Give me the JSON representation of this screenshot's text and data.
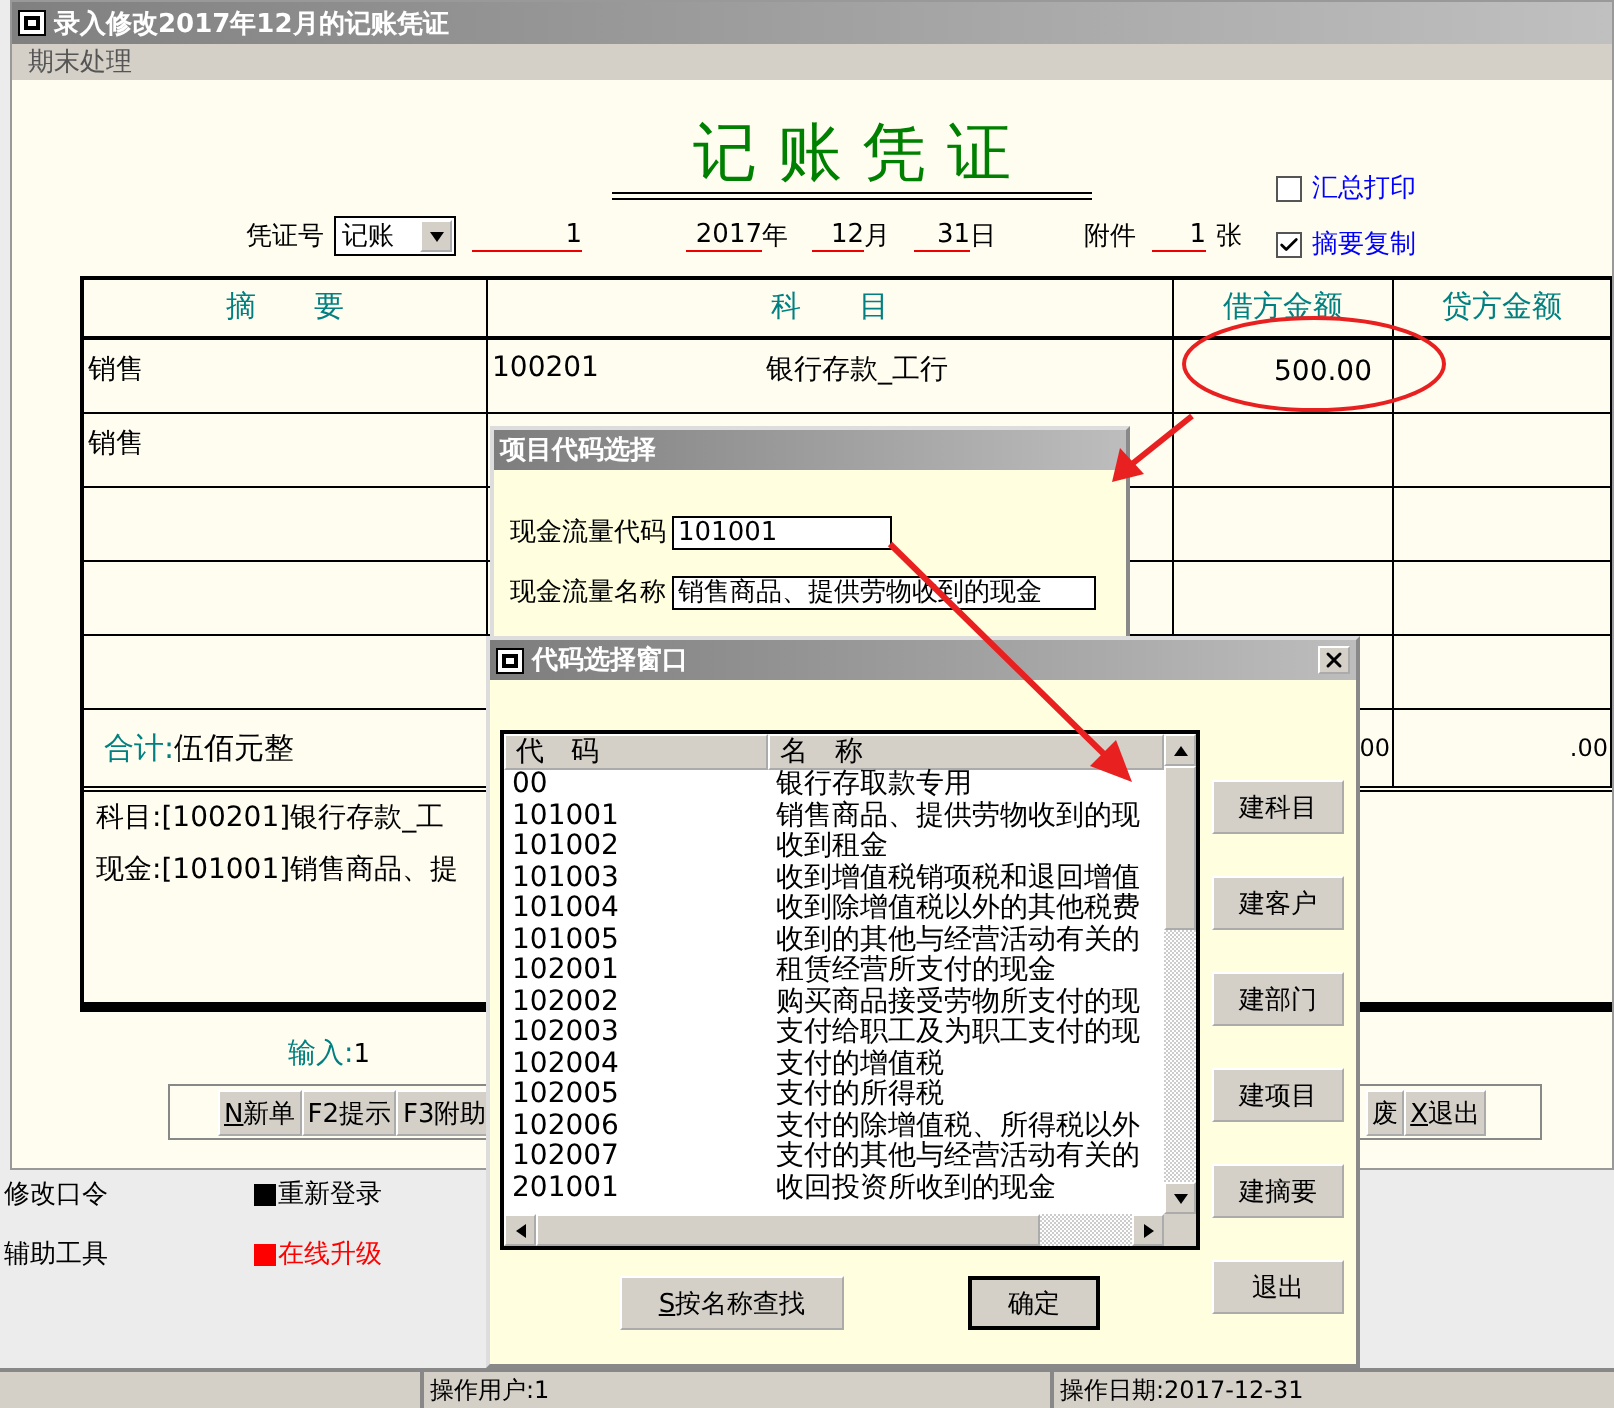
{
  "main_window": {
    "title": "录入修改2017年12月的记账凭证",
    "menu": [
      "期末处理"
    ],
    "voucher_title": "记 账 凭 证",
    "options": [
      {
        "label": "汇总打印",
        "checked": false
      },
      {
        "label": "摘要复制",
        "checked": true
      }
    ],
    "header_fields": {
      "voucher_no_label": "凭证号",
      "voucher_type": "记账",
      "voucher_no": "1",
      "year": "2017",
      "year_unit": "年",
      "month": "12",
      "month_unit": "月",
      "day": "31",
      "day_unit": "日",
      "attachments_label": "附件",
      "attachments": "1",
      "attachments_unit": "张"
    },
    "table": {
      "columns": [
        "摘      要",
        "科      目",
        "借方金额",
        "贷方金额"
      ],
      "rows": [
        {
          "summary": "销售",
          "account_code": "100201",
          "account_name": "银行存款_工行",
          "debit": "500.00"
        },
        {
          "summary": "销售"
        },
        {},
        {},
        {}
      ],
      "total": {
        "label": "合计:",
        "amount_words": "伍佰元整",
        "debit": "00",
        "credit": ".00"
      }
    },
    "details": [
      "科目:[100201]银行存款_工",
      "现金:[101001]销售商品、提"
    ],
    "input_status": {
      "label": "输入:",
      "value": "1"
    },
    "toolbar": [
      {
        "accel": "N",
        "label": "新单"
      },
      {
        "label": "F2提示"
      },
      {
        "label": "F3附助"
      },
      {
        "label": "废"
      },
      {
        "accel": "X",
        "label": "退出"
      }
    ]
  },
  "project_dialog": {
    "title": "项目代码选择",
    "fields": [
      {
        "label": "现金流量代码",
        "value": "101001"
      },
      {
        "label": "现金流量名称",
        "value": "销售商品、提供劳物收到的现金"
      }
    ]
  },
  "code_dialog": {
    "title": "代码选择窗口",
    "columns": [
      "代   码",
      "名   称"
    ],
    "rows": [
      {
        "code": "00",
        "name": "银行存取款专用"
      },
      {
        "code": "101001",
        "name": "销售商品、提供劳物收到的现"
      },
      {
        "code": "101002",
        "name": "收到租金"
      },
      {
        "code": "101003",
        "name": "收到增值税销项税和退回增值"
      },
      {
        "code": "101004",
        "name": "收到除增值税以外的其他税费"
      },
      {
        "code": "101005",
        "name": "收到的其他与经营活动有关的"
      },
      {
        "code": "102001",
        "name": "租赁经营所支付的现金"
      },
      {
        "code": "102002",
        "name": "购买商品接受劳物所支付的现"
      },
      {
        "code": "102003",
        "name": "支付给职工及为职工支付的现"
      },
      {
        "code": "102004",
        "name": "支付的增值税"
      },
      {
        "code": "102005",
        "name": "支付的所得税"
      },
      {
        "code": "102006",
        "name": "支付的除增值税、所得税以外"
      },
      {
        "code": "102007",
        "name": "支付的其他与经营活动有关的"
      },
      {
        "code": "201001",
        "name": "收回投资所收到的现金"
      }
    ],
    "side_buttons": [
      "建科目",
      "建客户",
      "建部门",
      "建项目",
      "建摘要",
      "退出"
    ],
    "bottom_buttons": [
      {
        "accel": "S",
        "label": "按名称查找",
        "default": false
      },
      {
        "label": "确定",
        "default": true
      }
    ]
  },
  "desktop": {
    "left_items": [
      "修改口令",
      "辅助工具"
    ],
    "right_items": [
      {
        "label": "重新登录",
        "color": "#000000"
      },
      {
        "label": "在线升级",
        "color": "#ff0000"
      }
    ]
  },
  "status_bar": [
    "操作用户:1",
    "操作日期:2017-12-31"
  ]
}
